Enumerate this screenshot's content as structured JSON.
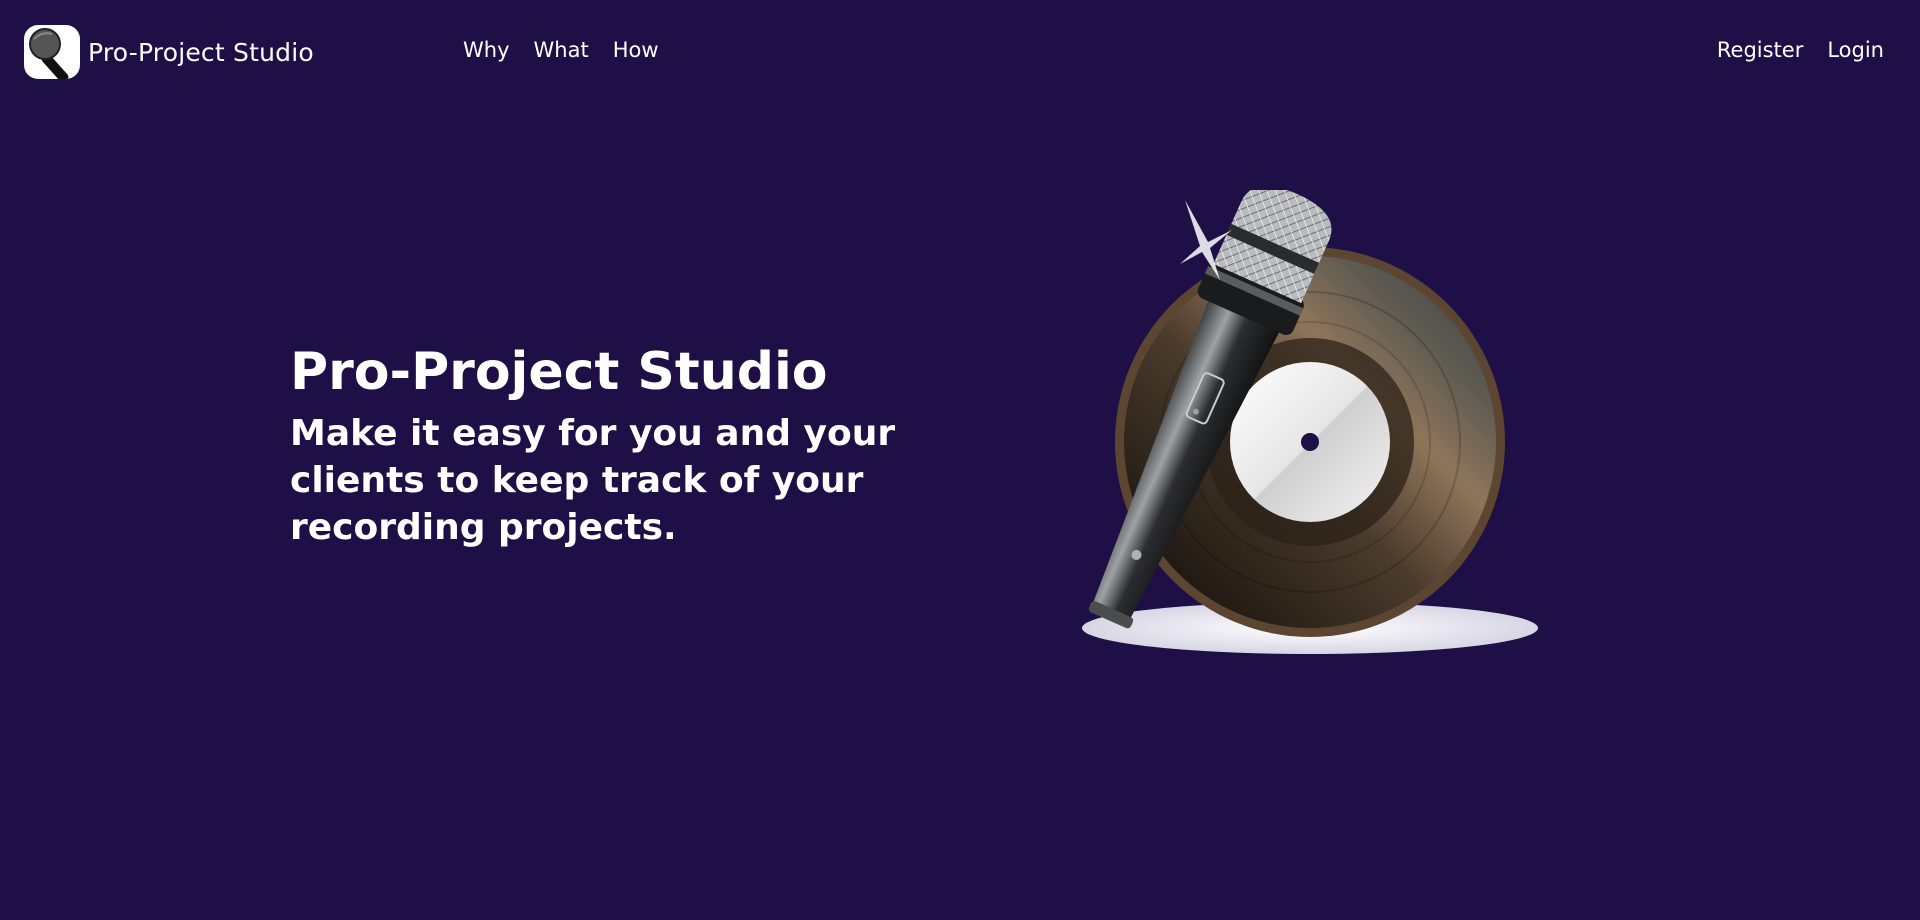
{
  "brand": {
    "name": "Pro-Project Studio",
    "logo_icon": "microphone-icon"
  },
  "nav": {
    "primary": [
      {
        "label": "Why"
      },
      {
        "label": "What"
      },
      {
        "label": "How"
      }
    ],
    "account": [
      {
        "label": "Register"
      },
      {
        "label": "Login"
      }
    ]
  },
  "hero": {
    "title": "Pro-Project Studio",
    "subtitle": "Make it easy for you and your clients to keep track of your recording projects.",
    "illustration": "microphone-and-vinyl-record-illustration"
  },
  "colors": {
    "background": "#1e1046",
    "text": "#ffffff",
    "record_brown": "#8c7258",
    "record_label": "#e8e8e8"
  }
}
